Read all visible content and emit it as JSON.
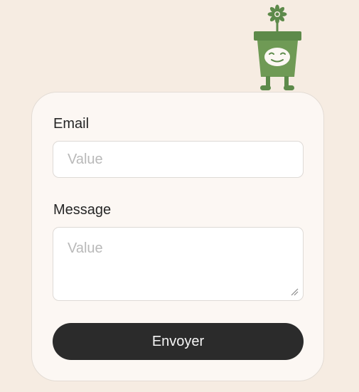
{
  "form": {
    "email_label": "Email",
    "email_placeholder": "Value",
    "email_value": "",
    "message_label": "Message",
    "message_placeholder": "Value",
    "message_value": "",
    "submit_label": "Envoyer"
  },
  "mascot": {
    "icon": "potted-plant-mascot-icon",
    "color": "#5d8a4a"
  },
  "colors": {
    "page_background": "#f6ece2",
    "card_background": "#fcf7f3",
    "button_background": "#2b2b2b"
  }
}
